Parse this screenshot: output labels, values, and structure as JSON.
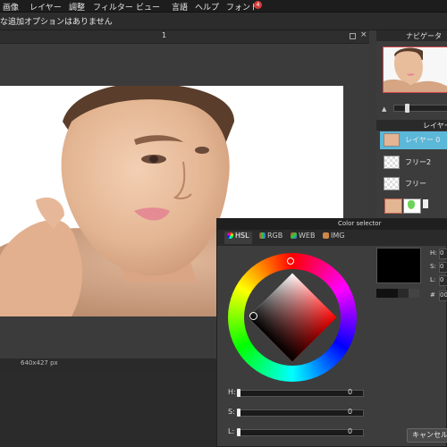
{
  "menu": {
    "items": [
      "画像",
      "レイヤー",
      "調整",
      "フィルター",
      "ビュー",
      "言語",
      "ヘルプ",
      "フォント"
    ],
    "font_badge": "4"
  },
  "options_bar": {
    "text": "な追加オプションはありません"
  },
  "document": {
    "title": "1",
    "status": "640x427 px"
  },
  "navigator": {
    "title": "ナビゲータ"
  },
  "layers": {
    "title": "レイヤー",
    "items": [
      {
        "name": "レイヤー 0",
        "selected": true
      },
      {
        "name": "フリー2",
        "selected": false
      },
      {
        "name": "フリー",
        "selected": false
      }
    ]
  },
  "color_selector": {
    "title": "Color selector",
    "tabs": [
      "HSL",
      "RGB",
      "WEB",
      "IMG"
    ],
    "active_tab": "HSL",
    "sliders": [
      {
        "label": "H:",
        "value": "0"
      },
      {
        "label": "S:",
        "value": "0"
      },
      {
        "label": "L:",
        "value": "0"
      }
    ],
    "right_fields": [
      {
        "label": "H:",
        "value": "0"
      },
      {
        "label": "S:",
        "value": "0"
      },
      {
        "label": "L:",
        "value": "0"
      }
    ],
    "hex_label": "#",
    "hex_value": "00",
    "cancel_label": "キャンセル",
    "current_color": "#000000"
  },
  "colors": {
    "accent": "#5bb8d9",
    "badge": "#d23b3b"
  }
}
